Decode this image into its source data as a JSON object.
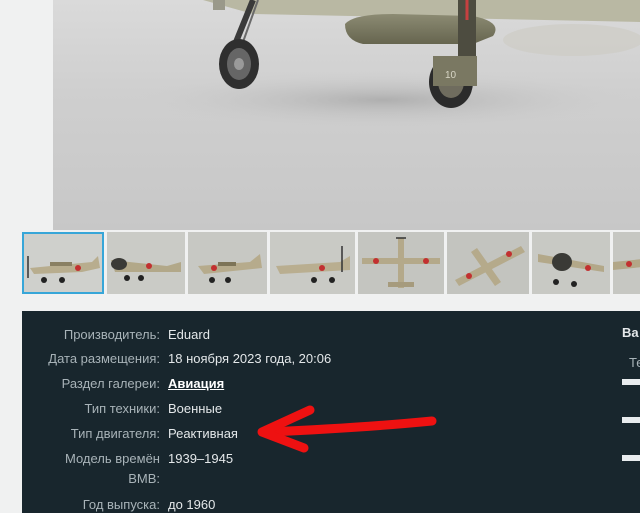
{
  "gallery": {
    "main_photo": {
      "icon": "aircraft-model-photo"
    },
    "thumbnails": [
      {
        "name": "thumb-1",
        "icon": "aircraft-side-view"
      },
      {
        "name": "thumb-2",
        "icon": "aircraft-front-left-view"
      },
      {
        "name": "thumb-3",
        "icon": "aircraft-side-view"
      },
      {
        "name": "thumb-4",
        "icon": "aircraft-side-view"
      },
      {
        "name": "thumb-5",
        "icon": "aircraft-top-view"
      },
      {
        "name": "thumb-6",
        "icon": "aircraft-underside-view"
      },
      {
        "name": "thumb-7",
        "icon": "aircraft-front-view"
      },
      {
        "name": "thumb-8",
        "icon": "aircraft-partial-view"
      }
    ],
    "active_thumbnail": 0
  },
  "specs": {
    "manufacturer": {
      "label": "Производитель:",
      "value": "Eduard"
    },
    "date": {
      "label": "Дата размещения:",
      "value": "18 ноября 2023 года, 20:06"
    },
    "section": {
      "label": "Раздел галереи:",
      "value": "Авиация"
    },
    "tech_type": {
      "label": "Тип техники:",
      "value": "Военные"
    },
    "engine_type": {
      "label": "Тип двигателя:",
      "value": "Реактивная"
    },
    "era": {
      "label_line1": "Модель времён",
      "label_line2": "ВМВ:",
      "value": "1939–1945"
    },
    "year": {
      "label": "Год выпуска:",
      "value": "до 1960"
    }
  },
  "right_column": {
    "title": "Ва",
    "subtitle": "Те"
  },
  "colors": {
    "panel_bg": "#18262d",
    "active_thumb_border": "#37a6d8",
    "annotation_arrow": "#ee1111"
  }
}
